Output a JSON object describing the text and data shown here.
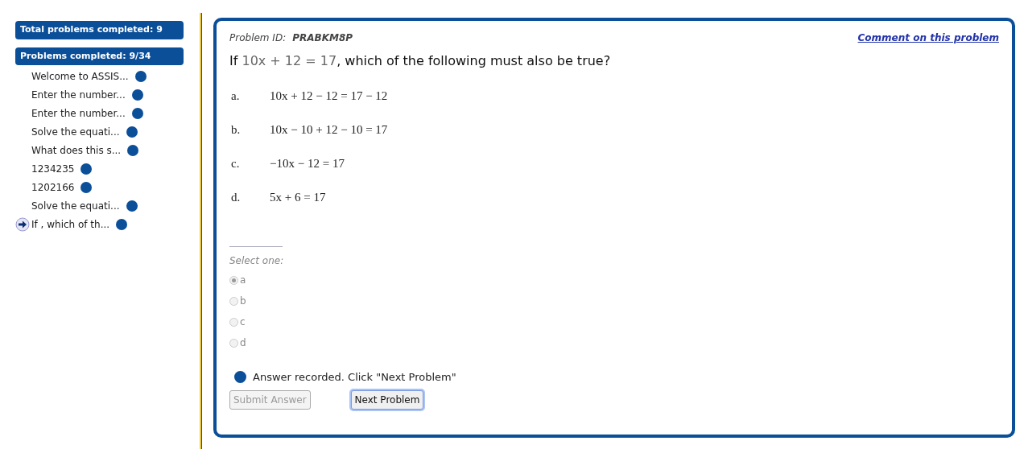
{
  "sidebar": {
    "total": "Total problems completed: 9",
    "progress": "Problems completed: 9/34",
    "items": [
      {
        "label": "Welcome to ASSIS...",
        "current": false
      },
      {
        "label": "Enter the number...",
        "current": false
      },
      {
        "label": "Enter the number...",
        "current": false
      },
      {
        "label": "Solve the equati...",
        "current": false
      },
      {
        "label": "What does this s...",
        "current": false
      },
      {
        "label": "1234235",
        "current": false
      },
      {
        "label": "1202166",
        "current": false
      },
      {
        "label": "Solve the equati...",
        "current": false
      },
      {
        "label": "If , which of th...",
        "current": true
      }
    ]
  },
  "problem": {
    "id_label": "Problem ID:",
    "id": "PRABKM8P",
    "comment_link": "Comment on this problem",
    "question": {
      "prefix": "If",
      "math": "10x + 12 = 17",
      "suffix": ", which of the following must also be true?"
    },
    "choices": [
      {
        "letter": "a.",
        "equation": "10x + 12 − 12 = 17 − 12"
      },
      {
        "letter": "b.",
        "equation": "10x − 10 + 12 − 10 = 17"
      },
      {
        "letter": "c.",
        "equation": "−10x − 12 = 17"
      },
      {
        "letter": "d.",
        "equation": "5x + 6 = 17"
      }
    ],
    "select_label": "Select one:",
    "options": [
      {
        "label": "a",
        "selected": true,
        "disabled": true
      },
      {
        "label": "b",
        "selected": false,
        "disabled": true
      },
      {
        "label": "c",
        "selected": false,
        "disabled": true
      },
      {
        "label": "d",
        "selected": false,
        "disabled": true
      }
    ],
    "status": "Answer recorded. Click \"Next Problem\"",
    "buttons": [
      {
        "label": "Submit Answer",
        "disabled": true
      },
      {
        "label": "Next Problem",
        "disabled": false
      }
    ]
  }
}
